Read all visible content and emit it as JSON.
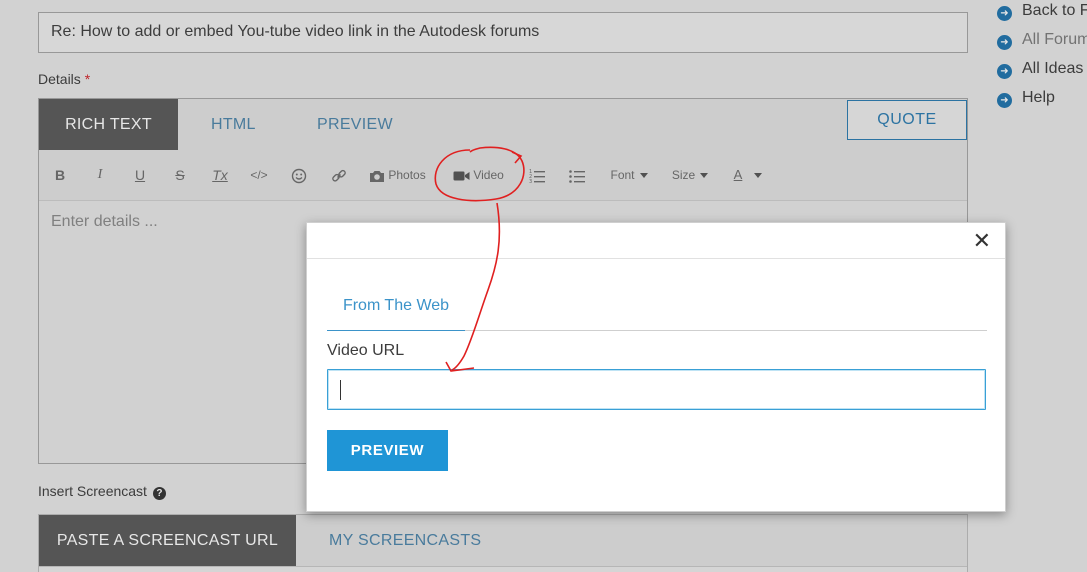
{
  "subject": {
    "value": "Re: How to add or embed You-tube video link in the Autodesk forums"
  },
  "details": {
    "label": "Details",
    "required_mark": "*"
  },
  "editor": {
    "tabs": [
      "RICH TEXT",
      "HTML",
      "PREVIEW"
    ],
    "toolbar": {
      "bold": "B",
      "italic": "I",
      "underline": "U",
      "strike": "S",
      "clear_format": "Tx",
      "code": "</>",
      "photos_label": "Photos",
      "video_label": "Video",
      "font_label": "Font",
      "size_label": "Size",
      "color_label": "A"
    },
    "quote_label": "QUOTE",
    "placeholder": "Enter details ..."
  },
  "screencast": {
    "label": "Insert Screencast",
    "help_glyph": "?",
    "tabs": [
      "PASTE A SCREENCAST URL",
      "MY SCREENCASTS"
    ]
  },
  "sidebar": {
    "items": [
      {
        "label": "Back to F",
        "icon": "arrow-right-circle-icon"
      },
      {
        "label": "All Forum",
        "icon": "arrow-right-circle-icon"
      },
      {
        "label": "All Ideas",
        "icon": "arrow-right-circle-icon"
      },
      {
        "label": "Help",
        "icon": "arrow-right-circle-icon"
      }
    ]
  },
  "modal": {
    "close_glyph": "✕",
    "tab_label": "From The Web",
    "url_label": "Video URL",
    "url_value": "",
    "preview_label": "PREVIEW"
  },
  "colors": {
    "accent_blue": "#1f95d6",
    "tab_dark": "#595959",
    "link_blue": "#4c84aa",
    "annotation_red": "#e02020"
  }
}
